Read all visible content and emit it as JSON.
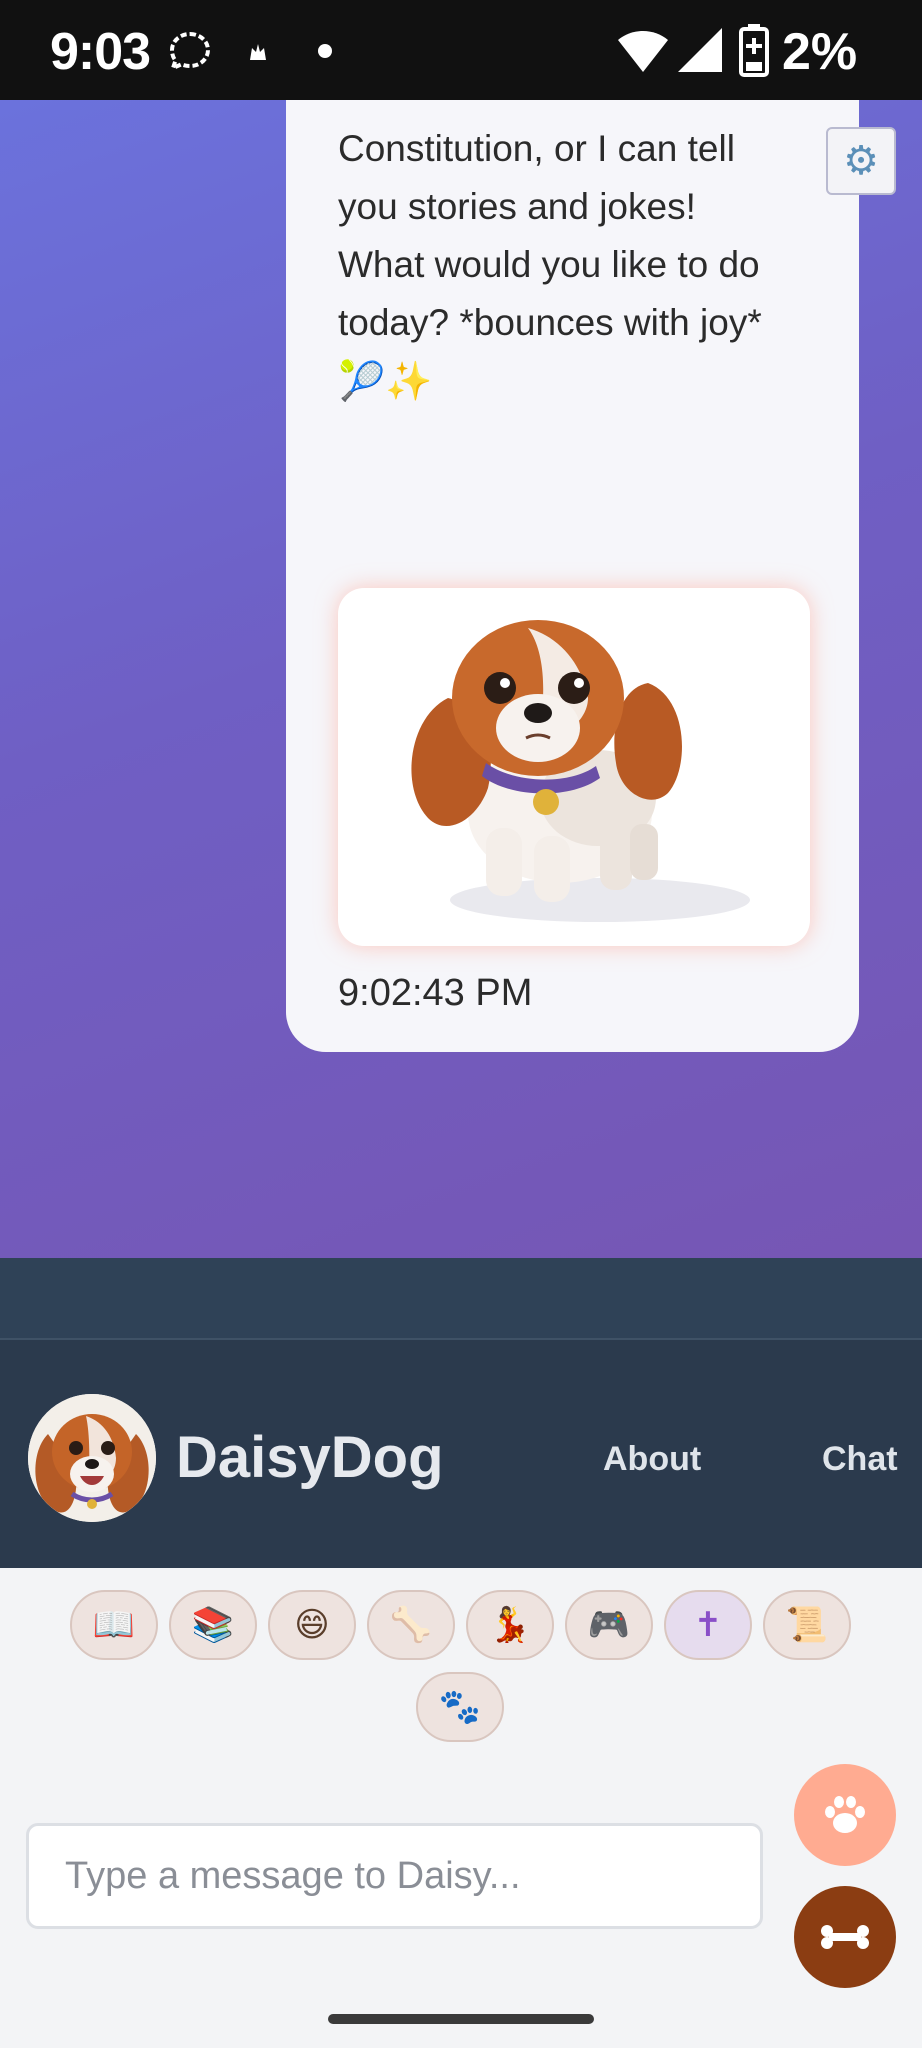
{
  "status_bar": {
    "time": "9:03",
    "battery": "2%",
    "icons": [
      "chat-bubble-icon",
      "notification-dot-icon",
      "dot-icon",
      "wifi-icon",
      "cell-signal-icon",
      "battery-charging-icon"
    ]
  },
  "chat": {
    "message_lines": [
      "Constitution, or I can tell",
      "you stories and jokes!",
      "What would you like to do",
      "today? *bounces with joy*"
    ],
    "message_emoji": "🎾✨",
    "timestamp": "9:02:43 PM",
    "image_name": "cavalier-king-charles-spaniel-image",
    "settings_icon": "⚙"
  },
  "header": {
    "brand": "DaisyDog",
    "nav": [
      "About",
      "Chat"
    ]
  },
  "quick_actions": [
    {
      "icon": "📖",
      "name": "book-icon"
    },
    {
      "icon": "📚",
      "name": "books-icon"
    },
    {
      "icon": "😄",
      "name": "grin-icon"
    },
    {
      "icon": "🦴",
      "name": "bone-icon"
    },
    {
      "icon": "💃",
      "name": "dancer-icon"
    },
    {
      "icon": "🎮",
      "name": "game-controller-icon"
    },
    {
      "icon": "✝",
      "name": "cross-icon"
    },
    {
      "icon": "📜",
      "name": "scroll-icon"
    },
    {
      "icon": "🐾",
      "name": "paw-prints-icon"
    }
  ],
  "input": {
    "placeholder": "Type a message to Daisy...",
    "value": ""
  },
  "colors": {
    "chat_gradient_start": "#6b72dc",
    "chat_gradient_end": "#7656b4",
    "header_bg": "#2b3a4d",
    "paw_fab": "#ffab91",
    "bone_fab": "#8b3d12"
  }
}
